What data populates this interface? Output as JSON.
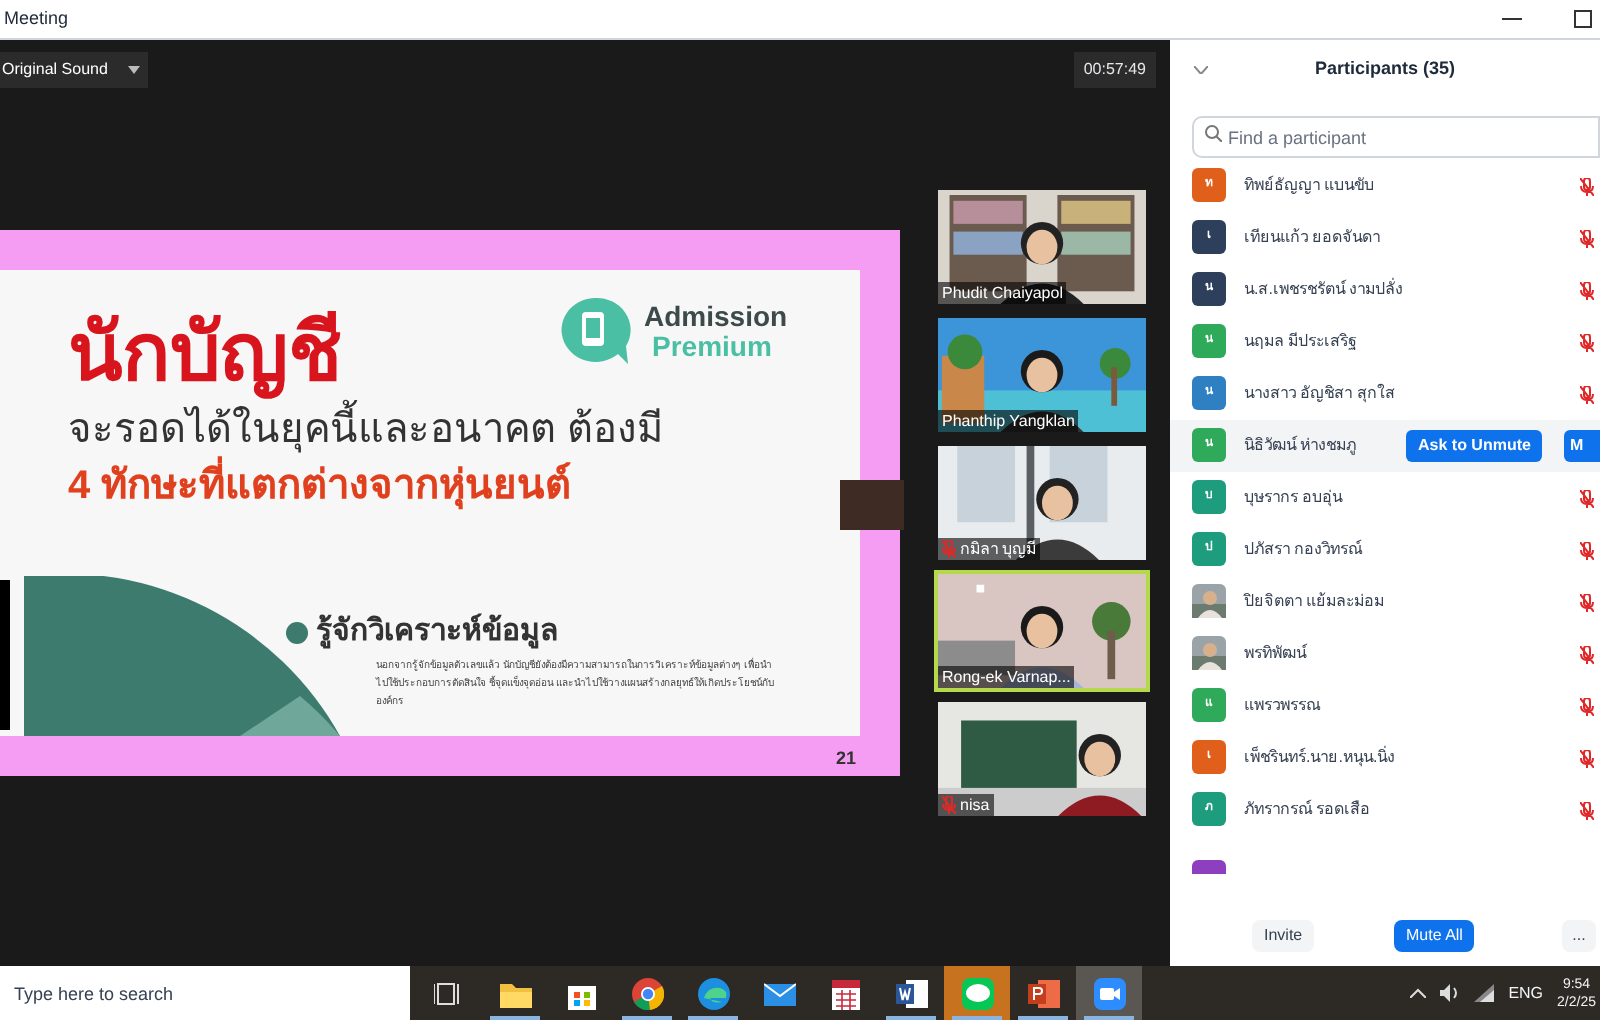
{
  "window": {
    "title": "Meeting"
  },
  "toolbar": {
    "sound_button": "Original Sound",
    "timer": "00:57:49"
  },
  "slide": {
    "title": "นักบัญชี",
    "line_1": "จะรอดได้ในยุคนี้และอนาคต ต้องมี",
    "line_2": "4 ทักษะที่แตกต่างจากหุ่นยนต์",
    "logo_top": "Admission",
    "logo_bottom": "Premium",
    "bullet": "รู้จักวิเคราะห์ข้อมูล",
    "paragraph": "นอกจากรู้จักข้อมูลตัวเลขแล้ว นักบัญชียังต้องมีความสามารถในการวิเคราะห์ข้อมูลต่างๆ เพื่อนำไปใช้ประกอบการตัดสินใจ ชี้จุดแข็งจุดอ่อน และนำไปใช้วางแผนสร้างกลยุทธ์ให้เกิดประโยชน์กับองค์กร",
    "page": "21"
  },
  "videos": [
    {
      "name": "Phudit Chaiyapol",
      "muted": false,
      "speaking": false
    },
    {
      "name": "Phanthip Yangklan",
      "muted": false,
      "speaking": false
    },
    {
      "name": "กมิลา บุญมี",
      "muted": true,
      "speaking": false
    },
    {
      "name": "Rong-ek Varnap...",
      "muted": false,
      "speaking": true
    },
    {
      "name": "nisa",
      "muted": true,
      "speaking": false
    }
  ],
  "participants": {
    "title": "Participants (35)",
    "search": {
      "placeholder": "Find a participant"
    },
    "items": [
      {
        "name": "ทิพย์ธัญญา แบนขับ",
        "avatar": {
          "kind": "initial",
          "initial": "ท",
          "color": "#e0601b"
        },
        "muted": true,
        "hovered": false
      },
      {
        "name": "เทียนแก้ว ยอดจันดา",
        "avatar": {
          "kind": "initial",
          "initial": "เ",
          "color": "#2e3f5c"
        },
        "muted": true,
        "hovered": false
      },
      {
        "name": "น.ส.เพชรชรัตน์ งามปลั่ง",
        "avatar": {
          "kind": "initial",
          "initial": "น",
          "color": "#2e3f5c"
        },
        "muted": true,
        "hovered": false
      },
      {
        "name": "นฤมล มีประเสริฐ",
        "avatar": {
          "kind": "initial",
          "initial": "น",
          "color": "#2eaa5a"
        },
        "muted": true,
        "hovered": false
      },
      {
        "name": "นางสาว อัญชิสา สุกใส",
        "avatar": {
          "kind": "initial",
          "initial": "น",
          "color": "#2f80c2"
        },
        "muted": true,
        "hovered": false
      },
      {
        "name": "นิธิวัฒน์ ห่างชมภู",
        "avatar": {
          "kind": "initial",
          "initial": "น",
          "color": "#2eaa5a"
        },
        "hovered": true,
        "ask_button": "Ask to Unmute",
        "more_button": "M"
      },
      {
        "name": "บุษรากร อบอุ่น",
        "avatar": {
          "kind": "initial",
          "initial": "บ",
          "color": "#1e9c7e"
        },
        "muted": true,
        "hovered": false
      },
      {
        "name": "ปภัสรา กองวิทรณ์",
        "avatar": {
          "kind": "initial",
          "initial": "ป",
          "color": "#1e9c7e"
        },
        "muted": true,
        "hovered": false
      },
      {
        "name": "ปิยจิตตา แย้มละม่อม",
        "muted": true,
        "hovered": false
      },
      {
        "name": "พรทิพัฒน์",
        "muted": true,
        "hovered": false
      },
      {
        "name": "แพรวพรรณ",
        "avatar": {
          "kind": "initial",
          "initial": "แ",
          "color": "#2eaa5a"
        },
        "muted": true,
        "hovered": false
      },
      {
        "name": "เพ็ชรินทร์.นาย.หนุน.นิ่ง",
        "avatar": {
          "kind": "initial",
          "initial": "เ",
          "color": "#e0601b"
        },
        "muted": true,
        "hovered": false
      },
      {
        "name": "ภัทรากรณ์ รอดเสือ",
        "avatar": {
          "kind": "initial",
          "initial": "ภ",
          "color": "#1e9c7e"
        },
        "muted": true,
        "hovered": false
      },
      {
        "avatar": {
          "kind": "partial",
          "color": "#8e3fbf"
        },
        "hovered": false
      }
    ],
    "invite_button": "Invite",
    "mute_all_button": "Mute All",
    "more_button": "..."
  },
  "taskbar": {
    "search": {
      "placeholder": "Type here to search"
    },
    "apps": [
      {
        "kind": "taskview",
        "open": false,
        "flashing": false,
        "selected": false
      },
      {
        "kind": "explorer",
        "open": true,
        "flashing": false,
        "selected": false
      },
      {
        "kind": "store",
        "open": false,
        "flashing": false,
        "selected": false
      },
      {
        "kind": "chrome",
        "open": true,
        "flashing": false,
        "selected": false
      },
      {
        "kind": "edge",
        "open": true,
        "flashing": false,
        "selected": false
      },
      {
        "kind": "mail",
        "open": false,
        "flashing": false,
        "selected": false
      },
      {
        "kind": "calendar",
        "open": false,
        "flashing": false,
        "selected": false
      },
      {
        "kind": "word",
        "open": true,
        "flashing": false,
        "selected": false
      },
      {
        "kind": "line",
        "open": true,
        "flashing": true,
        "selected": false
      },
      {
        "kind": "powerpoint",
        "open": true,
        "flashing": false,
        "selected": false
      },
      {
        "kind": "zoom",
        "open": true,
        "flashing": false,
        "selected": true
      }
    ],
    "language": "ENG",
    "time": "9:54",
    "date": "2/2/25"
  }
}
